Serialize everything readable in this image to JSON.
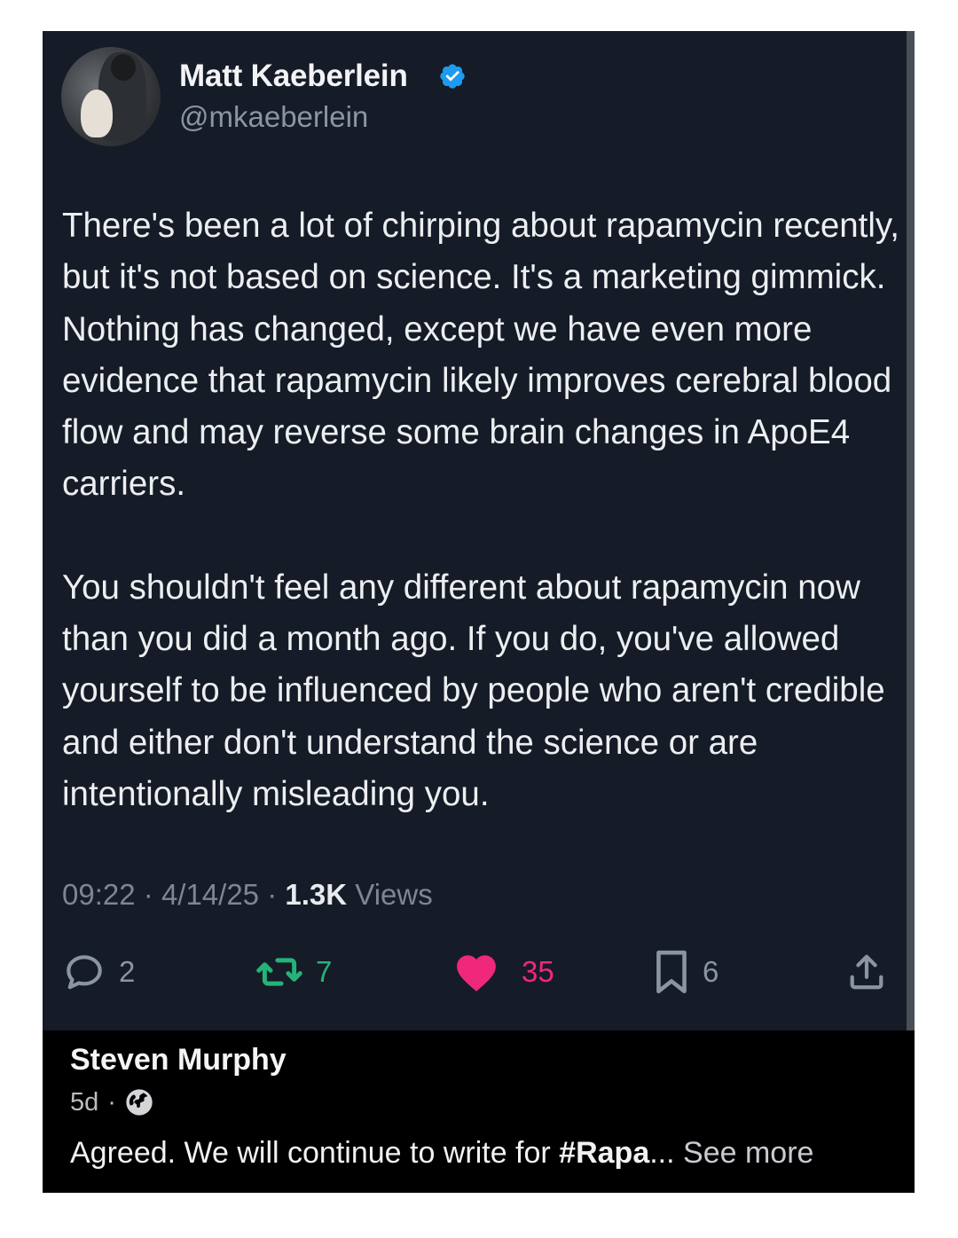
{
  "tweet": {
    "author": {
      "name": "Matt Kaeberlein",
      "handle": "@mkaeberlein",
      "verified": true,
      "verified_color": "#1d9bf0"
    },
    "paragraphs": [
      "There's been a lot of chirping about rapamycin recently, but it's not based on science. It's a marketing gimmick. Nothing has changed, except we have even more evidence that rapamycin likely improves cerebral blood flow and may reverse some brain changes in ApoE4 carriers.",
      "You shouldn't feel any different about rapamycin now than you did a month ago. If you do, you've allowed yourself to be influenced by people who aren't credible and either don't understand the science or are intentionally misleading you."
    ],
    "time": "09:22",
    "date": "4/14/25",
    "separator": "·",
    "views_count": "1.3K",
    "views_label": "Views",
    "actions": {
      "replies": "2",
      "reposts": "7",
      "likes": "35",
      "bookmarks": "6"
    },
    "liked": true,
    "colors": {
      "background": "#151b27",
      "repost": "#25b37a",
      "like": "#f0287a"
    }
  },
  "comment": {
    "author": "Steven Murphy",
    "age": "5d",
    "separator": "·",
    "visibility_icon": "globe-icon",
    "text_start": "Agreed. We will continue to write for ",
    "hashtag_partial": "#Rapa",
    "ellipsis": "...",
    "see_more": "See more"
  }
}
